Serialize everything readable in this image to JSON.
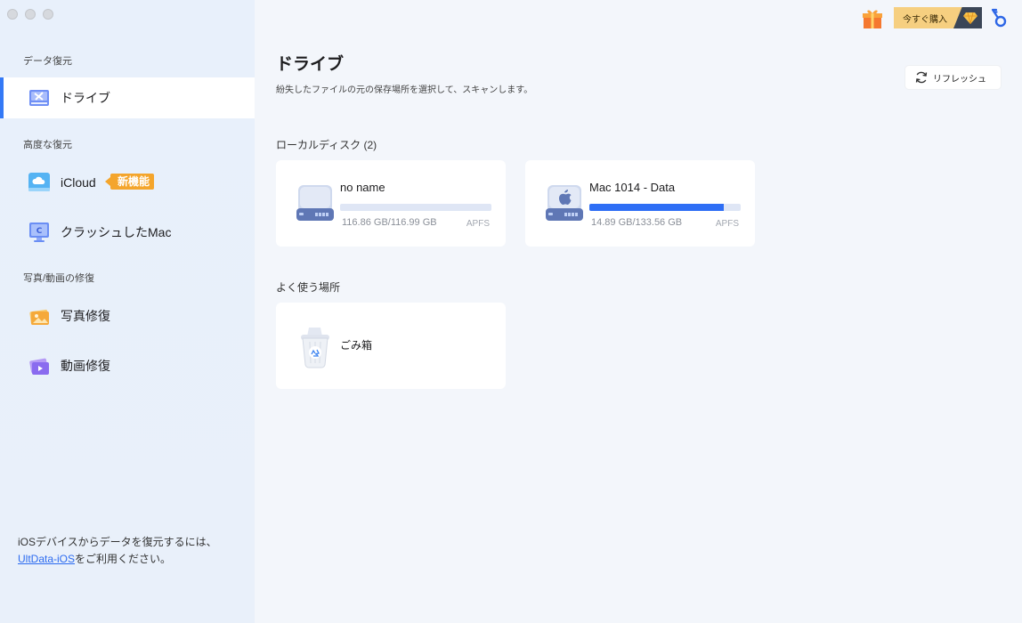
{
  "window": {
    "controls": [
      "close",
      "minimize",
      "zoom"
    ]
  },
  "sidebar": {
    "sections": [
      {
        "label": "データ復元",
        "items": [
          {
            "label": "ドライブ",
            "icon": "drive-tools-icon",
            "active": true
          }
        ]
      },
      {
        "label": "高度な復元",
        "items": [
          {
            "label": "iCloud",
            "icon": "icloud-icon",
            "badge": "新機能"
          },
          {
            "label": "クラッシュしたMac",
            "icon": "crashed-mac-icon"
          }
        ]
      },
      {
        "label": "写真/動画の修復",
        "items": [
          {
            "label": "写真修復",
            "icon": "photo-repair-icon"
          },
          {
            "label": "動画修復",
            "icon": "video-repair-icon"
          }
        ]
      }
    ],
    "footer": {
      "line1": "iOSデバイスからデータを復元するには、",
      "link": "UltData-iOS",
      "line2": "をご利用ください。"
    }
  },
  "header": {
    "buy_label": "今すぐ購入",
    "icons": [
      "gift-icon",
      "diamond-icon",
      "key-icon"
    ]
  },
  "main": {
    "title": "ドライブ",
    "subtitle": "紛失したファイルの元の保存場所を選択して、スキャンします。",
    "refresh_label": "リフレッシュ",
    "local_disks": {
      "title": "ローカルディスク (2)",
      "disks": [
        {
          "name": "no name",
          "size": "116.86 GB/116.99 GB",
          "fs": "APFS",
          "usage": 0.0
        },
        {
          "name": "Mac 1014 - Data",
          "size": "14.89 GB/133.56 GB",
          "fs": "APFS",
          "usage": 0.89
        }
      ]
    },
    "favorites": {
      "title": "よく使う場所",
      "items": [
        {
          "name": "ごみ箱",
          "icon": "trash-icon"
        }
      ]
    }
  },
  "colors": {
    "accent": "#3479f6",
    "badge": "#f4a52c",
    "buy": "#f6cf80",
    "bar_fill": "#2e6ef5"
  }
}
